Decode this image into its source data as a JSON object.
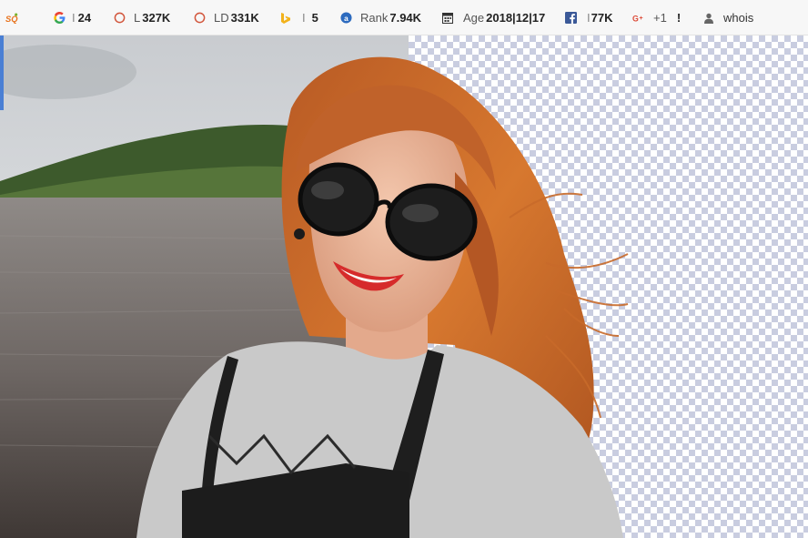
{
  "toolbar": {
    "logo_text": "SQ",
    "google_index": {
      "sep": "I",
      "value": "24"
    },
    "links": {
      "label": "L",
      "value": "327K"
    },
    "links_domain": {
      "label": "LD",
      "value": "331K"
    },
    "bing_index": {
      "sep": "I",
      "value": "5"
    },
    "rank": {
      "label": "Rank",
      "value": "7.94K"
    },
    "age": {
      "label": "Age",
      "value": "2018|12|17"
    },
    "facebook": {
      "sep": "I",
      "value": "77K"
    },
    "gplus": {
      "label": "+1",
      "value": "!"
    },
    "whois": {
      "label": "whois"
    }
  },
  "colors": {
    "google_blue": "#4285f4",
    "google_red": "#ea4335",
    "google_yellow": "#fbbc05",
    "google_green": "#34a853",
    "circle_orange": "#d2553b",
    "bing_yellow": "#f2b21b",
    "rank_blue": "#2d6bbf",
    "facebook_blue": "#3b5998",
    "gplus_red": "#dd4b39",
    "checker_blue": "#c9cde0",
    "accent_blue": "#4a7fd4"
  },
  "image": {
    "subject": "smiling woman with red hair and sunglasses, background half removed showing transparency checkerboard"
  }
}
